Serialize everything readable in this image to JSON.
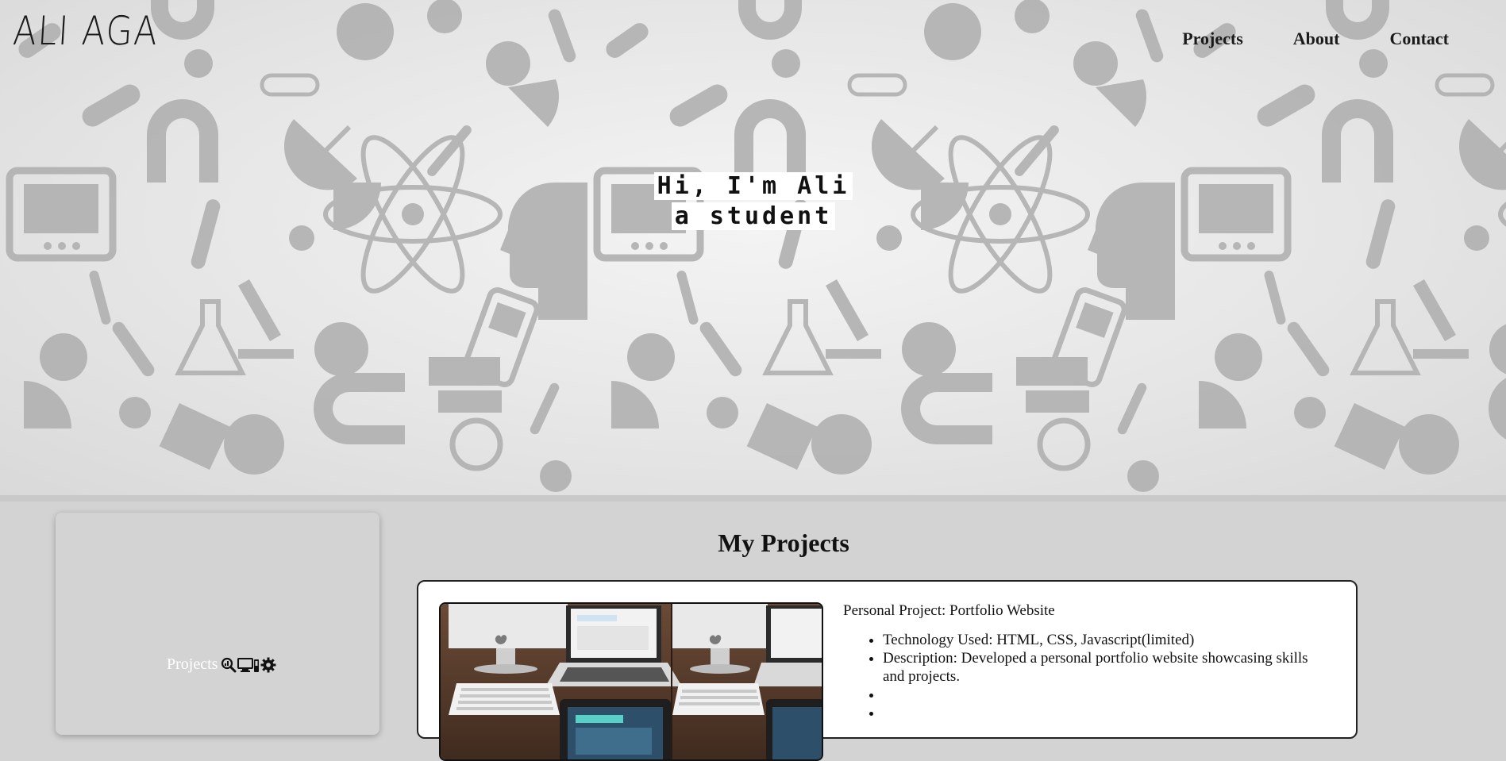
{
  "header": {
    "logo": "ALI AGA",
    "nav": [
      {
        "label": "Projects"
      },
      {
        "label": "About"
      },
      {
        "label": "Contact"
      }
    ]
  },
  "hero": {
    "line1": "Hi, I'm Ali",
    "line2": "a student"
  },
  "sidebar": {
    "link_label": "Projects",
    "icons": [
      "chart-search-icon",
      "computer-devices-icon",
      "gear-icon"
    ]
  },
  "projects": {
    "title": "My Projects",
    "items": [
      {
        "name": "Personal Project: Portfolio Website",
        "details": [
          "Technology Used: HTML, CSS, Javascript(limited)",
          "Description: Developed a personal portfolio website showcasing skills and projects.",
          "",
          ""
        ]
      }
    ]
  },
  "colors": {
    "page_background": "#d3d3d3",
    "hero_pattern": "#b3b3b3",
    "text": "#111111",
    "card_background": "#ffffff"
  }
}
